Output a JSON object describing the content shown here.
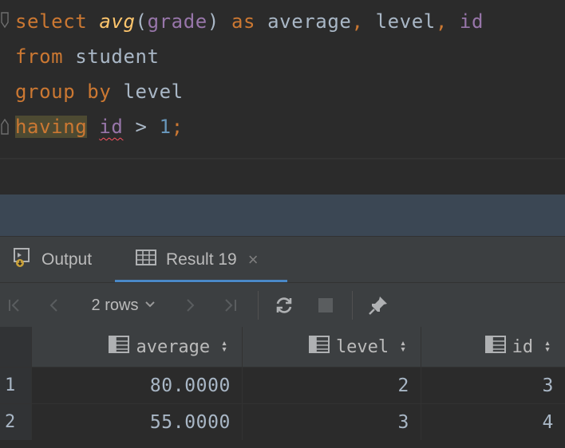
{
  "editor": {
    "lines": [
      [
        {
          "t": "select ",
          "c": "kw"
        },
        {
          "t": "avg",
          "c": "fn"
        },
        {
          "t": "(",
          "c": "plain"
        },
        {
          "t": "grade",
          "c": "field"
        },
        {
          "t": ") ",
          "c": "plain"
        },
        {
          "t": "as ",
          "c": "kw"
        },
        {
          "t": "average",
          "c": "plain"
        },
        {
          "t": ", ",
          "c": "kw"
        },
        {
          "t": "level",
          "c": "plain"
        },
        {
          "t": ", ",
          "c": "kw"
        },
        {
          "t": "id",
          "c": "field"
        }
      ],
      [
        {
          "t": "from ",
          "c": "kw"
        },
        {
          "t": "student",
          "c": "plain"
        }
      ],
      [
        {
          "t": "group by ",
          "c": "kw"
        },
        {
          "t": "level",
          "c": "plain"
        }
      ],
      [
        {
          "t": "having",
          "c": "kw hl"
        },
        {
          "t": " ",
          "c": "plain"
        },
        {
          "t": "id",
          "c": "field squiggle"
        },
        {
          "t": " > ",
          "c": "plain"
        },
        {
          "t": "1",
          "c": "num"
        },
        {
          "t": ";",
          "c": "kw"
        }
      ]
    ]
  },
  "tabs": {
    "output_label": "Output",
    "result_label": "Result 19",
    "close_glyph": "×"
  },
  "toolbar": {
    "rows_label": "2 rows"
  },
  "grid": {
    "columns": [
      "average",
      "level",
      "id"
    ],
    "rows": [
      {
        "num": "1",
        "cells": [
          "80.0000",
          "2",
          "3"
        ]
      },
      {
        "num": "2",
        "cells": [
          "55.0000",
          "3",
          "4"
        ]
      }
    ]
  },
  "colors": {
    "keyword": "#cc7832",
    "function": "#ffc66d",
    "field": "#9876aa",
    "number": "#6897bb",
    "tab_underline": "#4a88c7",
    "error_squiggle": "#ff5261"
  }
}
